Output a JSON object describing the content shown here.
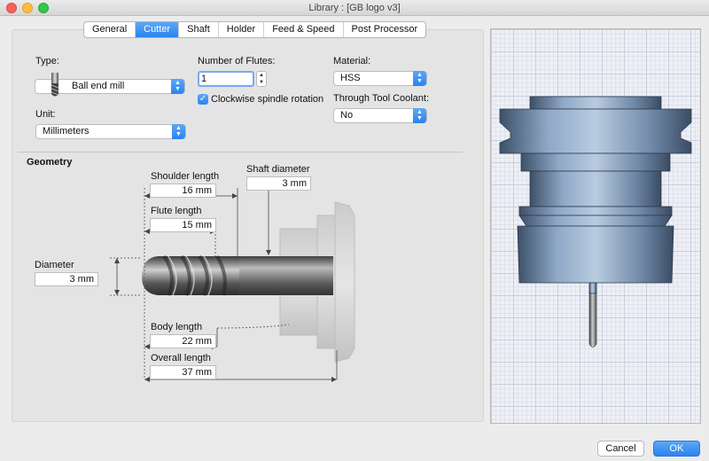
{
  "window": {
    "title": "Library : [GB logo v3]"
  },
  "tabs": [
    "General",
    "Cutter",
    "Shaft",
    "Holder",
    "Feed & Speed",
    "Post Processor"
  ],
  "cutter": {
    "type_label": "Type:",
    "type_value": "Ball end mill",
    "unit_label": "Unit:",
    "unit_value": "Millimeters",
    "flutes_label": "Number of Flutes:",
    "flutes_value": "1",
    "spindle_label": "Clockwise spindle rotation",
    "material_label": "Material:",
    "material_value": "HSS",
    "coolant_label": "Through Tool Coolant:",
    "coolant_value": "No"
  },
  "geometry": {
    "title": "Geometry",
    "shoulder_label": "Shoulder length",
    "shoulder_value": "16 mm",
    "flute_label": "Flute length",
    "flute_value": "15 mm",
    "shaft_label": "Shaft diameter",
    "shaft_value": "3 mm",
    "diameter_label": "Diameter",
    "diameter_value": "3 mm",
    "body_label": "Body length",
    "body_value": "22 mm",
    "overall_label": "Overall length",
    "overall_value": "37 mm"
  },
  "buttons": {
    "cancel": "Cancel",
    "ok": "OK"
  },
  "colors": {
    "accent": "#2b83f0",
    "holder": "#7892b0"
  }
}
